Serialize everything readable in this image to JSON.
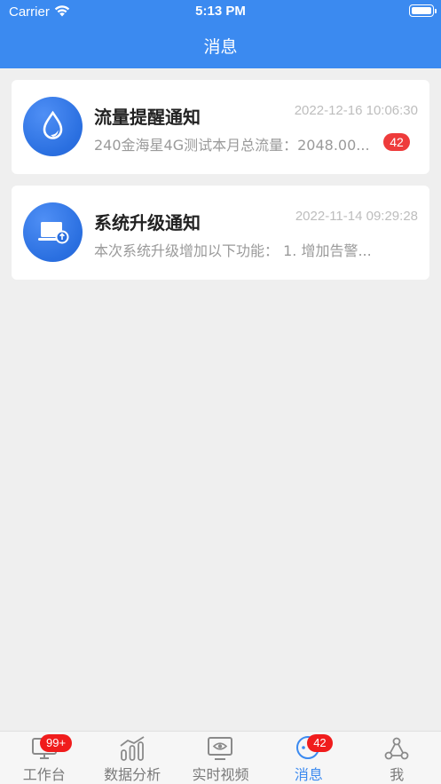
{
  "status_bar": {
    "carrier": "Carrier",
    "time": "5:13 PM"
  },
  "header": {
    "title": "消息",
    "background": "#3b8af0"
  },
  "messages": [
    {
      "icon": "water-drop-icon",
      "title": "流量提醒通知",
      "time": "2022-12-16 10:06:30",
      "preview": "240金海星4G测试本月总流量：2048.00...",
      "badge": "42"
    },
    {
      "icon": "system-upgrade-icon",
      "title": "系统升级通知",
      "time": "2022-11-14 09:29:28",
      "preview": "本次系统升级增加以下功能： 1. 增加告警..."
    }
  ],
  "tabbar": {
    "items": [
      {
        "label": "工作台",
        "icon": "monitor-icon",
        "badge": "99+"
      },
      {
        "label": "数据分析",
        "icon": "bar-chart-icon"
      },
      {
        "label": "实时视频",
        "icon": "video-monitor-icon"
      },
      {
        "label": "消息",
        "icon": "message-icon",
        "badge": "42",
        "active": true
      },
      {
        "label": "我",
        "icon": "profile-network-icon"
      }
    ],
    "active_color": "#3b8af0",
    "badge_color": "#f01c1c"
  }
}
